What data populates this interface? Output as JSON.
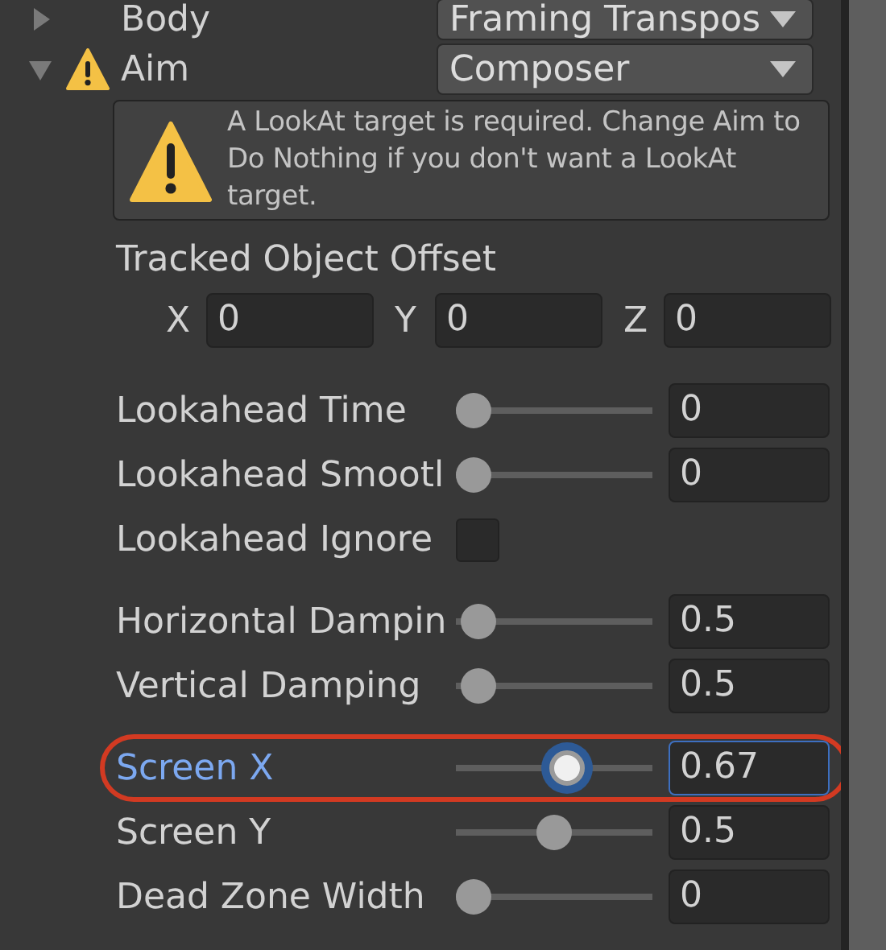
{
  "body_row": {
    "label": "Body",
    "expanded": false,
    "dropdown": "Framing Transpos"
  },
  "aim_row": {
    "label": "Aim",
    "expanded": true,
    "warning": true,
    "dropdown": "Composer"
  },
  "help_box": {
    "kind": "warning",
    "text": "A LookAt target is required.  Change Aim to Do Nothing if you don't want a LookAt target."
  },
  "tracked_object_offset": {
    "label": "Tracked Object Offset",
    "fields": [
      {
        "label": "X",
        "value": "0"
      },
      {
        "label": "Y",
        "value": "0"
      },
      {
        "label": "Z",
        "value": "0"
      }
    ]
  },
  "groups": [
    [
      {
        "kind": "slider",
        "label": "Lookahead Time",
        "level": 0,
        "value": "0",
        "focused": false,
        "circled": false
      },
      {
        "kind": "slider",
        "label": "Lookahead Smootl",
        "level": 0,
        "value": "0",
        "focused": false,
        "circled": false
      },
      {
        "kind": "checkbox",
        "label": "Lookahead Ignore",
        "checked": false
      }
    ],
    [
      {
        "kind": "slider",
        "label": "Horizontal Dampin",
        "level": 0.03,
        "value": "0.5",
        "focused": false,
        "circled": false
      },
      {
        "kind": "slider",
        "label": "Vertical Damping",
        "level": 0.03,
        "value": "0.5",
        "focused": false,
        "circled": false
      }
    ],
    [
      {
        "kind": "slider",
        "label": "Screen X",
        "level": 0.58,
        "value": "0.67",
        "focused": true,
        "circled": true
      },
      {
        "kind": "slider",
        "label": "Screen Y",
        "level": 0.5,
        "value": "0.5",
        "focused": false,
        "circled": false
      },
      {
        "kind": "slider",
        "label": "Dead Zone Width",
        "level": 0,
        "value": "0",
        "focused": false,
        "circled": false
      }
    ]
  ]
}
